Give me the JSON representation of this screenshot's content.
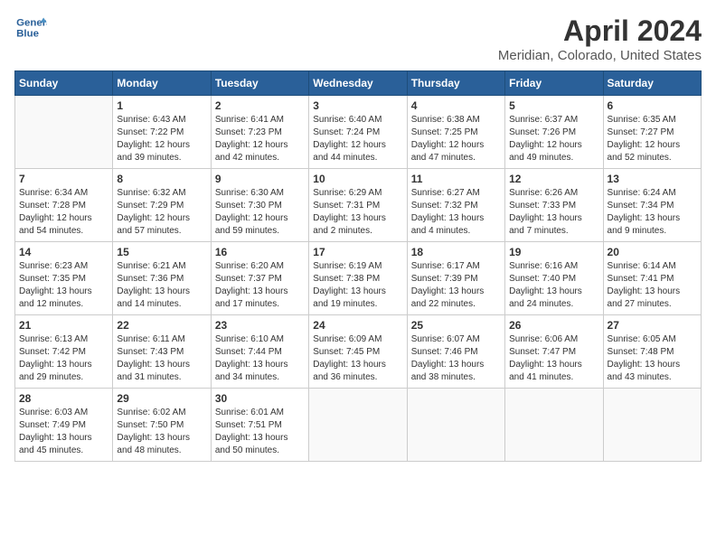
{
  "header": {
    "logo_line1": "General",
    "logo_line2": "Blue",
    "title": "April 2024",
    "subtitle": "Meridian, Colorado, United States"
  },
  "weekdays": [
    "Sunday",
    "Monday",
    "Tuesday",
    "Wednesday",
    "Thursday",
    "Friday",
    "Saturday"
  ],
  "weeks": [
    [
      {
        "day": "",
        "sunrise": "",
        "sunset": "",
        "daylight": ""
      },
      {
        "day": "1",
        "sunrise": "Sunrise: 6:43 AM",
        "sunset": "Sunset: 7:22 PM",
        "daylight": "Daylight: 12 hours and 39 minutes."
      },
      {
        "day": "2",
        "sunrise": "Sunrise: 6:41 AM",
        "sunset": "Sunset: 7:23 PM",
        "daylight": "Daylight: 12 hours and 42 minutes."
      },
      {
        "day": "3",
        "sunrise": "Sunrise: 6:40 AM",
        "sunset": "Sunset: 7:24 PM",
        "daylight": "Daylight: 12 hours and 44 minutes."
      },
      {
        "day": "4",
        "sunrise": "Sunrise: 6:38 AM",
        "sunset": "Sunset: 7:25 PM",
        "daylight": "Daylight: 12 hours and 47 minutes."
      },
      {
        "day": "5",
        "sunrise": "Sunrise: 6:37 AM",
        "sunset": "Sunset: 7:26 PM",
        "daylight": "Daylight: 12 hours and 49 minutes."
      },
      {
        "day": "6",
        "sunrise": "Sunrise: 6:35 AM",
        "sunset": "Sunset: 7:27 PM",
        "daylight": "Daylight: 12 hours and 52 minutes."
      }
    ],
    [
      {
        "day": "7",
        "sunrise": "Sunrise: 6:34 AM",
        "sunset": "Sunset: 7:28 PM",
        "daylight": "Daylight: 12 hours and 54 minutes."
      },
      {
        "day": "8",
        "sunrise": "Sunrise: 6:32 AM",
        "sunset": "Sunset: 7:29 PM",
        "daylight": "Daylight: 12 hours and 57 minutes."
      },
      {
        "day": "9",
        "sunrise": "Sunrise: 6:30 AM",
        "sunset": "Sunset: 7:30 PM",
        "daylight": "Daylight: 12 hours and 59 minutes."
      },
      {
        "day": "10",
        "sunrise": "Sunrise: 6:29 AM",
        "sunset": "Sunset: 7:31 PM",
        "daylight": "Daylight: 13 hours and 2 minutes."
      },
      {
        "day": "11",
        "sunrise": "Sunrise: 6:27 AM",
        "sunset": "Sunset: 7:32 PM",
        "daylight": "Daylight: 13 hours and 4 minutes."
      },
      {
        "day": "12",
        "sunrise": "Sunrise: 6:26 AM",
        "sunset": "Sunset: 7:33 PM",
        "daylight": "Daylight: 13 hours and 7 minutes."
      },
      {
        "day": "13",
        "sunrise": "Sunrise: 6:24 AM",
        "sunset": "Sunset: 7:34 PM",
        "daylight": "Daylight: 13 hours and 9 minutes."
      }
    ],
    [
      {
        "day": "14",
        "sunrise": "Sunrise: 6:23 AM",
        "sunset": "Sunset: 7:35 PM",
        "daylight": "Daylight: 13 hours and 12 minutes."
      },
      {
        "day": "15",
        "sunrise": "Sunrise: 6:21 AM",
        "sunset": "Sunset: 7:36 PM",
        "daylight": "Daylight: 13 hours and 14 minutes."
      },
      {
        "day": "16",
        "sunrise": "Sunrise: 6:20 AM",
        "sunset": "Sunset: 7:37 PM",
        "daylight": "Daylight: 13 hours and 17 minutes."
      },
      {
        "day": "17",
        "sunrise": "Sunrise: 6:19 AM",
        "sunset": "Sunset: 7:38 PM",
        "daylight": "Daylight: 13 hours and 19 minutes."
      },
      {
        "day": "18",
        "sunrise": "Sunrise: 6:17 AM",
        "sunset": "Sunset: 7:39 PM",
        "daylight": "Daylight: 13 hours and 22 minutes."
      },
      {
        "day": "19",
        "sunrise": "Sunrise: 6:16 AM",
        "sunset": "Sunset: 7:40 PM",
        "daylight": "Daylight: 13 hours and 24 minutes."
      },
      {
        "day": "20",
        "sunrise": "Sunrise: 6:14 AM",
        "sunset": "Sunset: 7:41 PM",
        "daylight": "Daylight: 13 hours and 27 minutes."
      }
    ],
    [
      {
        "day": "21",
        "sunrise": "Sunrise: 6:13 AM",
        "sunset": "Sunset: 7:42 PM",
        "daylight": "Daylight: 13 hours and 29 minutes."
      },
      {
        "day": "22",
        "sunrise": "Sunrise: 6:11 AM",
        "sunset": "Sunset: 7:43 PM",
        "daylight": "Daylight: 13 hours and 31 minutes."
      },
      {
        "day": "23",
        "sunrise": "Sunrise: 6:10 AM",
        "sunset": "Sunset: 7:44 PM",
        "daylight": "Daylight: 13 hours and 34 minutes."
      },
      {
        "day": "24",
        "sunrise": "Sunrise: 6:09 AM",
        "sunset": "Sunset: 7:45 PM",
        "daylight": "Daylight: 13 hours and 36 minutes."
      },
      {
        "day": "25",
        "sunrise": "Sunrise: 6:07 AM",
        "sunset": "Sunset: 7:46 PM",
        "daylight": "Daylight: 13 hours and 38 minutes."
      },
      {
        "day": "26",
        "sunrise": "Sunrise: 6:06 AM",
        "sunset": "Sunset: 7:47 PM",
        "daylight": "Daylight: 13 hours and 41 minutes."
      },
      {
        "day": "27",
        "sunrise": "Sunrise: 6:05 AM",
        "sunset": "Sunset: 7:48 PM",
        "daylight": "Daylight: 13 hours and 43 minutes."
      }
    ],
    [
      {
        "day": "28",
        "sunrise": "Sunrise: 6:03 AM",
        "sunset": "Sunset: 7:49 PM",
        "daylight": "Daylight: 13 hours and 45 minutes."
      },
      {
        "day": "29",
        "sunrise": "Sunrise: 6:02 AM",
        "sunset": "Sunset: 7:50 PM",
        "daylight": "Daylight: 13 hours and 48 minutes."
      },
      {
        "day": "30",
        "sunrise": "Sunrise: 6:01 AM",
        "sunset": "Sunset: 7:51 PM",
        "daylight": "Daylight: 13 hours and 50 minutes."
      },
      {
        "day": "",
        "sunrise": "",
        "sunset": "",
        "daylight": ""
      },
      {
        "day": "",
        "sunrise": "",
        "sunset": "",
        "daylight": ""
      },
      {
        "day": "",
        "sunrise": "",
        "sunset": "",
        "daylight": ""
      },
      {
        "day": "",
        "sunrise": "",
        "sunset": "",
        "daylight": ""
      }
    ]
  ]
}
